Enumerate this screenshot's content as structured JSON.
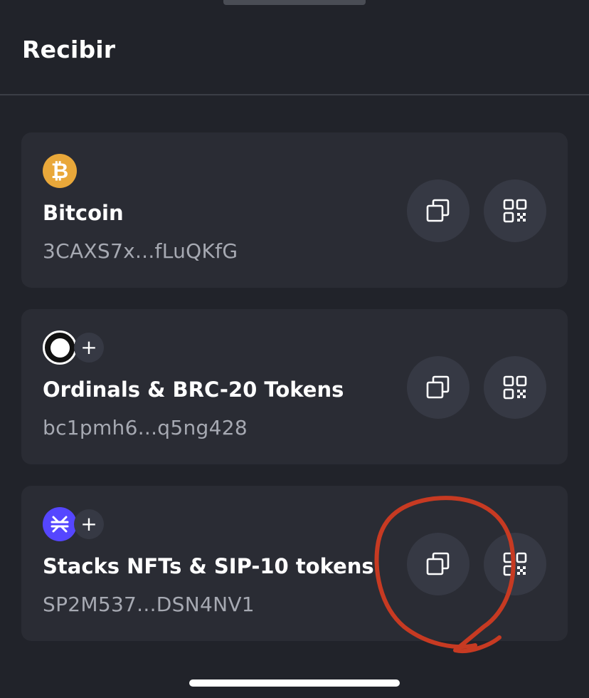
{
  "header": {
    "title": "Recibir"
  },
  "accounts": [
    {
      "name": "Bitcoin",
      "address": "3CAXS7x...fLuQKfG",
      "icon": "bitcoin-icon",
      "icon_glyph": "₿",
      "icon_color": "#e9a83a"
    },
    {
      "name": "Ordinals & BRC-20 Tokens",
      "address": "bc1pmh6...q5ng428",
      "icon": "ordinals-icon",
      "plus": "+"
    },
    {
      "name": "Stacks NFTs & SIP-10 tokens",
      "address": "SP2M537...DSN4NV1",
      "icon": "stacks-icon",
      "icon_glyph": "⋇",
      "icon_color": "#5546ff",
      "plus": "+"
    }
  ],
  "colors": {
    "background": "#21232a",
    "card": "#2a2c34",
    "button": "#363944",
    "annotation": "#c73a22"
  }
}
